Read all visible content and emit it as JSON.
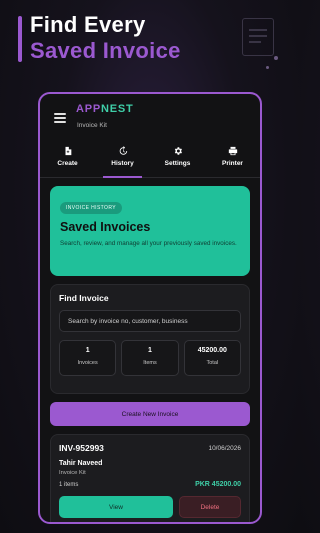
{
  "promo": {
    "line1": "Find Every",
    "line2": "Saved Invoice"
  },
  "app": {
    "brand_a": "APP",
    "brand_b": "NEST",
    "subtitle": "Invoice Kit"
  },
  "tabs": [
    {
      "label": "Create",
      "icon": "document-icon"
    },
    {
      "label": "History",
      "icon": "history-icon"
    },
    {
      "label": "Settings",
      "icon": "gear-icon"
    },
    {
      "label": "Printer",
      "icon": "printer-icon"
    }
  ],
  "hero": {
    "chip": "INVOICE HISTORY",
    "title": "Saved Invoices",
    "desc": "Search, review, and manage all your previously saved invoices."
  },
  "find": {
    "title": "Find Invoice",
    "placeholder": "Search by invoice no, customer, business",
    "stats": [
      {
        "value": "1",
        "label": "Invoices"
      },
      {
        "value": "1",
        "label": "Items"
      },
      {
        "value": "45200.00",
        "label": "Total"
      }
    ]
  },
  "create_button": "Create New Invoice",
  "invoice": {
    "number": "INV-952993",
    "date": "10/06/2026",
    "customer": "Tahir Naveed",
    "business": "Invoice Kit",
    "items": "1 items",
    "amount": "PKR 45200.00",
    "view_label": "View",
    "delete_label": "Delete"
  },
  "colors": {
    "accent_purple": "#9b59d0",
    "accent_green": "#20c09a",
    "danger": "#f07080"
  }
}
